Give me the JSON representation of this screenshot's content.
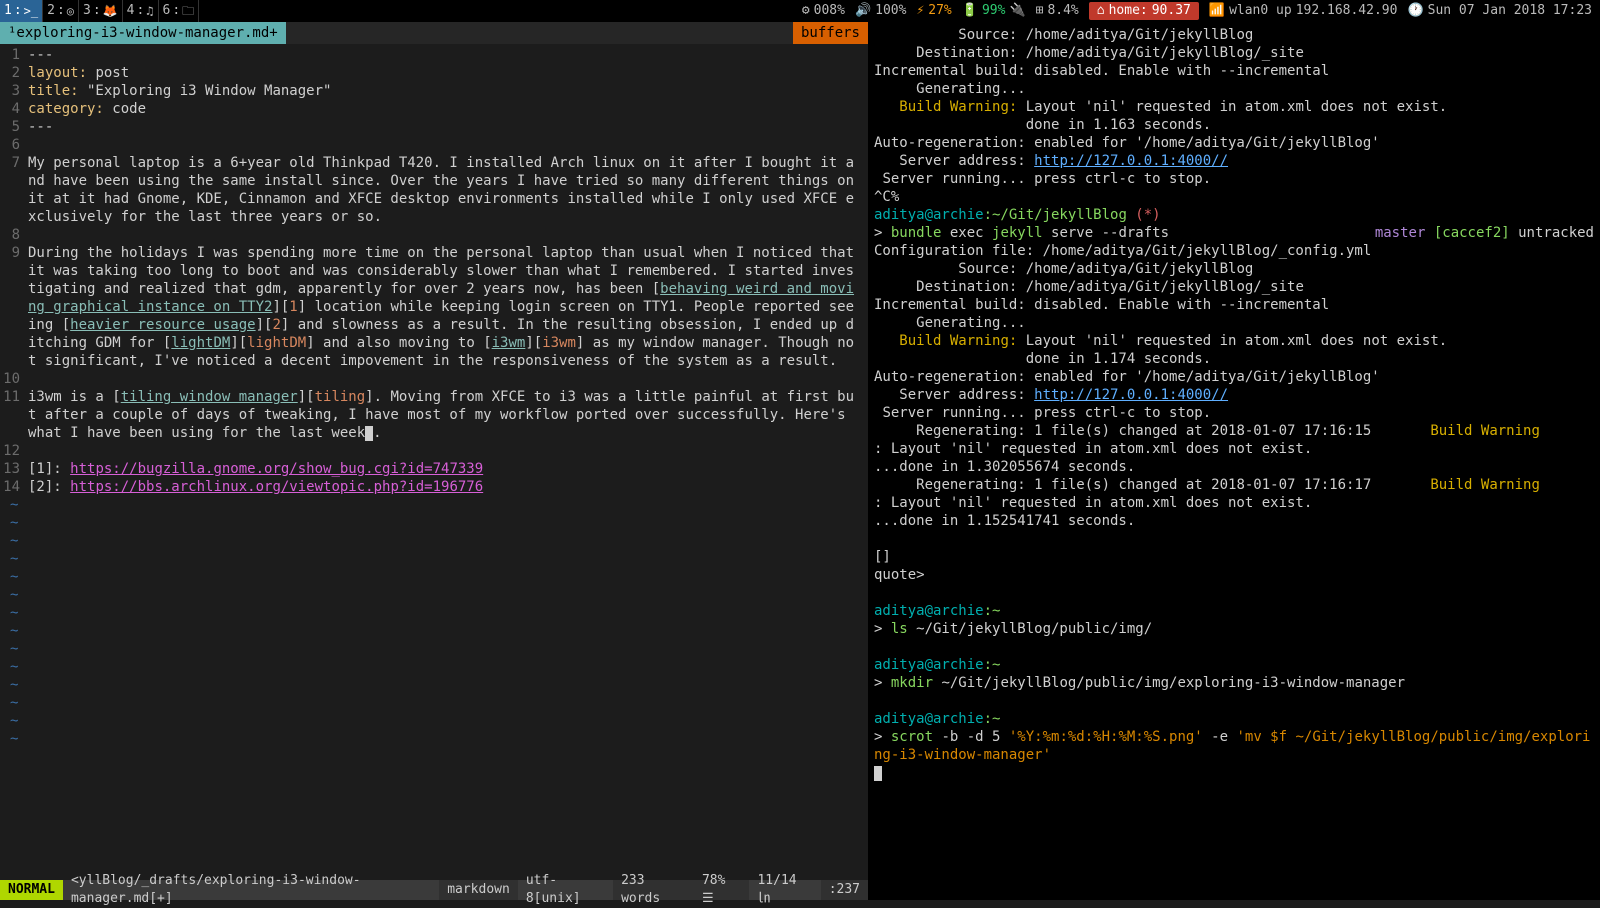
{
  "statusbar": {
    "workspaces": [
      {
        "num": "1",
        "icon": ">_"
      },
      {
        "num": "2",
        "icon": "◎"
      },
      {
        "num": "3",
        "icon": "🦊"
      },
      {
        "num": "4",
        "icon": "♫"
      },
      {
        "num": "6",
        "icon": "🗀"
      }
    ],
    "cpu": "008%",
    "volume": "100%",
    "brightness": "27%",
    "battery": "99%",
    "load": "8.4%",
    "home_label": "home:",
    "home_value": "90.37",
    "wifi": "wlan0 up",
    "ip": "192.168.42.90",
    "date": "Sun 07 Jan 2018 17:23"
  },
  "editor": {
    "tab": "¹exploring-i3-window-manager.md+",
    "buffers_label": "buffers",
    "lines": {
      "l1": "---",
      "l2_key": "layout:",
      "l2_val": " post",
      "l3_key": "title:",
      "l3_val": " \"Exploring i3 Window Manager\"",
      "l4_key": "category:",
      "l4_val": " code",
      "l5": "---",
      "l7": "My personal laptop is a 6+year old Thinkpad T420. I installed Arch linux on it after I bought it and have been using the same install since. Over the years I have tried so many different things on it at it had Gnome, KDE, Cinnamon and XFCE desktop environments installed while I only used XFCE exclusively for the last three years or so.",
      "l9_a": "During the holidays I was spending more time on the personal laptop than usual when I noticed that it was taking too long to boot and was considerably slower than what I remembered. I started investigating and realized that gdm, apparently for over 2 years now, has been [",
      "l9_link1": "behaving weird and moving graphical instance on TTY2",
      "l9_b": "][",
      "l9_ref1": "1",
      "l9_c": "] location while keeping login screen on TTY1. People reported seeing [",
      "l9_link2": "heavier resource usage",
      "l9_d": "][",
      "l9_ref2": "2",
      "l9_e": "] and slowness as a result. In the resulting obsession, I ended up ditching GDM for [",
      "l9_link3": "lightDM",
      "l9_f": "][",
      "l9_ref3": "lightDM",
      "l9_g": "] and also moving to [",
      "l9_link4": "i3wm",
      "l9_h": "][",
      "l9_ref4": "i3wm",
      "l9_i": "] as my window manager. Though not significant, I've noticed a decent impovement in the responsiveness of the system as a result.",
      "l11_a": "i3wm is a [",
      "l11_link": "tiling window manager",
      "l11_b": "][",
      "l11_ref": "tiling",
      "l11_c": "]. Moving from XFCE to i3 was a little painful at first but after a couple of days of tweaking, I have most of my workflow ported over successfully. Here's what I have been using for the last week",
      "l13_a": "[1]: ",
      "l13_url": "https://bugzilla.gnome.org/show_bug.cgi?id=747339",
      "l14_a": "[2]: ",
      "l14_url": "https://bbs.archlinux.org/viewtopic.php?id=196776"
    },
    "status": {
      "mode": "NORMAL",
      "file": "<yllBlog/_drafts/exploring-i3-window-manager.md[+]",
      "filetype": "markdown",
      "encoding": "utf-8[unix]",
      "words": "233 words",
      "percent": "78% ☰",
      "position": "11/14 ㏑",
      "col": ":237"
    }
  },
  "term": {
    "t01": "          Source: /home/aditya/Git/jekyllBlog",
    "t02": "     Destination: /home/aditya/Git/jekyllBlog/_site",
    "t03": "Incremental build: disabled. Enable with --incremental",
    "t04": "     Generating...",
    "t05a": "   Build Warning:",
    "t05b": " Layout 'nil' requested in atom.xml does not exist.",
    "t06": "                  done in 1.163 seconds.",
    "t07": "Auto-regeneration: enabled for '/home/aditya/Git/jekyllBlog'",
    "t08a": "   Server address: ",
    "t08b": "http://127.0.0.1:4000//",
    "t09": " Server running... press ctrl-c to stop.",
    "t10": "^C%",
    "p1_user": "aditya@archie",
    "p1_path": ":~/Git/jekyllBlog",
    "p1_star": " (*)",
    "c1a": "> ",
    "c1b": "bundle",
    "c1c": " exec ",
    "c1d": "jekyll",
    "c1e": " serve --drafts",
    "c1_branch": "master",
    "c1_hash": " [caccef2]",
    "c1_track": " untracked",
    "t11": "Configuration file: /home/aditya/Git/jekyllBlog/_config.yml",
    "t12": "          Source: /home/aditya/Git/jekyllBlog",
    "t13": "     Destination: /home/aditya/Git/jekyllBlog/_site",
    "t14": "Incremental build: disabled. Enable with --incremental",
    "t15": "     Generating...",
    "t16a": "   Build Warning:",
    "t16b": " Layout 'nil' requested in atom.xml does not exist.",
    "t17": "                  done in 1.174 seconds.",
    "t18": "Auto-regeneration: enabled for '/home/aditya/Git/jekyllBlog'",
    "t19a": "   Server address: ",
    "t19b": "http://127.0.0.1:4000//",
    "t20": " Server running... press ctrl-c to stop.",
    "t21a": "     Regenerating: 1 file(s) changed at 2018-01-07 17:16:15       ",
    "t21b": "Build Warning",
    "t22": ": Layout 'nil' requested in atom.xml does not exist.",
    "t23": "...done in 1.302055674 seconds.",
    "t24a": "     Regenerating: 1 file(s) changed at 2018-01-07 17:16:17       ",
    "t24b": "Build Warning",
    "t25": ": Layout 'nil' requested in atom.xml does not exist.",
    "t26": "...done in 1.152541741 seconds.",
    "t27": "[]",
    "t28": "quote>",
    "p2_user": "aditya@archie",
    "p2_path": ":~",
    "c2a": "> ",
    "c2b": "ls",
    "c2c": " ~/Git/jekyllBlog/public/img/",
    "p3_user": "aditya@archie",
    "p3_path": ":~",
    "c3a": "> ",
    "c3b": "mkdir",
    "c3c": " ~/Git/jekyllBlog/public/img/exploring-i3-window-manager",
    "p4_user": "aditya@archie",
    "p4_path": ":~",
    "c4a": "> ",
    "c4b": "scrot",
    "c4c": " -b -d 5 ",
    "c4d": "'%Y:%m:%d:%H:%M:%S.png'",
    "c4e": " -e ",
    "c4f": "'mv $f ~/Git/jekyllBlog/public/img/exploring-i3-window-manager'"
  }
}
